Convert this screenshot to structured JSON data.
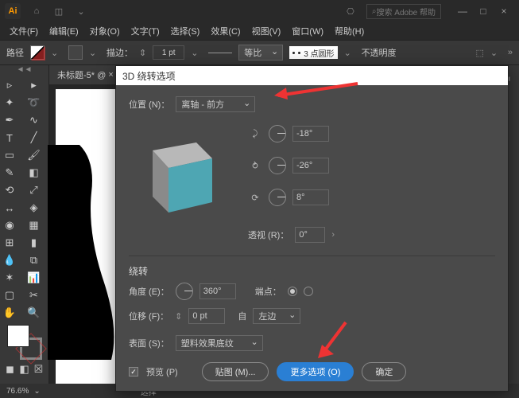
{
  "app": {
    "logo": "Ai",
    "search_placeholder": "搜索 Adobe 帮助"
  },
  "menu": [
    "文件(F)",
    "编辑(E)",
    "对象(O)",
    "文字(T)",
    "选择(S)",
    "效果(C)",
    "视图(V)",
    "窗口(W)",
    "帮助(H)"
  ],
  "props": {
    "path_label": "路径",
    "stroke_label": "描边：",
    "stroke_weight": "1 pt",
    "uniform": "等比",
    "round_label": "3 点圆形",
    "opacity_label": "不透明度"
  },
  "doc": {
    "tab": "未标题-5* @",
    "zoom": "76.6%"
  },
  "dialog": {
    "title": "3D 绕转选项",
    "position_label": "位置 (N)：",
    "position_value": "离轴 - 前方",
    "rot_x": "-18°",
    "rot_y": "-26°",
    "rot_z": "8°",
    "persp_label": "透视 (R)：",
    "persp_value": "0°",
    "section_revolve": "绕转",
    "angle_label": "角度 (E)：",
    "angle_value": "360°",
    "cap_label": "端点：",
    "offset_label": "位移 (F)：",
    "offset_value": "0 pt",
    "from_label": "自",
    "from_value": "左边",
    "surface_label": "表面 (S)：",
    "surface_value": "塑料效果底纹",
    "preview_label": "预览 (P)",
    "map_button": "贴图 (M)...",
    "more_button": "更多选项 (O)",
    "ok_button": "确定"
  },
  "status": {
    "label": "选择"
  }
}
